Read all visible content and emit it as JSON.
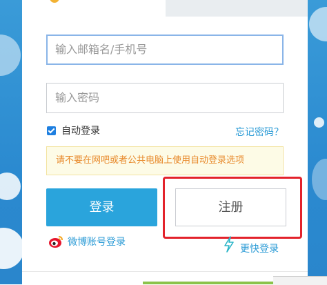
{
  "form": {
    "email_placeholder": "输入邮箱名/手机号",
    "password_placeholder": "输入密码",
    "auto_login_label": "自动登录",
    "auto_login_checked": true,
    "forgot_password_label": "忘记密码？",
    "warning_text": "请不要在网吧或者公共电脑上使用自动登录选项",
    "login_button": "登录",
    "register_button": "注册",
    "weibo_login_label": "微博账号登录",
    "fast_login_label": "更快登录"
  },
  "colors": {
    "accent": "#2aa4dc",
    "link": "#2b9bd6",
    "warning_text": "#e88a2c",
    "warning_bg": "#fdfbe6",
    "highlight_border": "#e3222b",
    "checkbox": "#1e7fe0"
  },
  "icons": {
    "weibo": "weibo-icon",
    "fast_login": "lightning-icon",
    "checkbox": "checkmark-icon"
  }
}
